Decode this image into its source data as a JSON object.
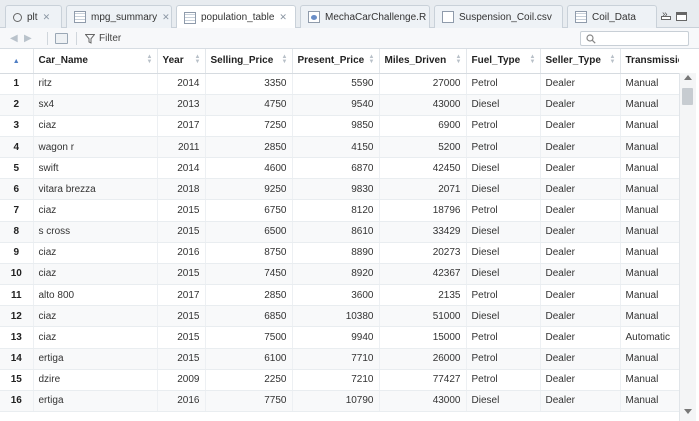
{
  "tabs": [
    {
      "label": "plt",
      "icon": "magnifier-icon"
    },
    {
      "label": "mpg_summary",
      "icon": "grid-icon"
    },
    {
      "label": "population_table",
      "icon": "grid-icon",
      "active": true
    },
    {
      "label": "MechaCarChallenge.R",
      "icon": "r-script-icon"
    },
    {
      "label": "Suspension_Coil.csv",
      "icon": "document-icon"
    },
    {
      "label": "Coil_Data",
      "icon": "grid-icon"
    }
  ],
  "tab_close_glyph": "✕",
  "tab_overflow_glyph": "»",
  "toolbar": {
    "back_glyph": "◀",
    "forward_glyph": "▶",
    "filter_label": "Filter"
  },
  "search": {
    "placeholder": ""
  },
  "table": {
    "columns": [
      "Car_Name",
      "Year",
      "Selling_Price",
      "Present_Price",
      "Miles_Driven",
      "Fuel_Type",
      "Seller_Type",
      "Transmission"
    ],
    "rows": [
      [
        "1",
        "ritz",
        "2014",
        "3350",
        "5590",
        "27000",
        "Petrol",
        "Dealer",
        "Manual"
      ],
      [
        "2",
        "sx4",
        "2013",
        "4750",
        "9540",
        "43000",
        "Diesel",
        "Dealer",
        "Manual"
      ],
      [
        "3",
        "ciaz",
        "2017",
        "7250",
        "9850",
        "6900",
        "Petrol",
        "Dealer",
        "Manual"
      ],
      [
        "4",
        "wagon r",
        "2011",
        "2850",
        "4150",
        "5200",
        "Petrol",
        "Dealer",
        "Manual"
      ],
      [
        "5",
        "swift",
        "2014",
        "4600",
        "6870",
        "42450",
        "Diesel",
        "Dealer",
        "Manual"
      ],
      [
        "6",
        "vitara brezza",
        "2018",
        "9250",
        "9830",
        "2071",
        "Diesel",
        "Dealer",
        "Manual"
      ],
      [
        "7",
        "ciaz",
        "2015",
        "6750",
        "8120",
        "18796",
        "Petrol",
        "Dealer",
        "Manual"
      ],
      [
        "8",
        "s cross",
        "2015",
        "6500",
        "8610",
        "33429",
        "Diesel",
        "Dealer",
        "Manual"
      ],
      [
        "9",
        "ciaz",
        "2016",
        "8750",
        "8890",
        "20273",
        "Diesel",
        "Dealer",
        "Manual"
      ],
      [
        "10",
        "ciaz",
        "2015",
        "7450",
        "8920",
        "42367",
        "Diesel",
        "Dealer",
        "Manual"
      ],
      [
        "11",
        "alto 800",
        "2017",
        "2850",
        "3600",
        "2135",
        "Petrol",
        "Dealer",
        "Manual"
      ],
      [
        "12",
        "ciaz",
        "2015",
        "6850",
        "10380",
        "51000",
        "Diesel",
        "Dealer",
        "Manual"
      ],
      [
        "13",
        "ciaz",
        "2015",
        "7500",
        "9940",
        "15000",
        "Petrol",
        "Dealer",
        "Automatic"
      ],
      [
        "14",
        "ertiga",
        "2015",
        "6100",
        "7710",
        "26000",
        "Petrol",
        "Dealer",
        "Manual"
      ],
      [
        "15",
        "dzire",
        "2009",
        "2250",
        "7210",
        "77427",
        "Petrol",
        "Dealer",
        "Manual"
      ],
      [
        "16",
        "ertiga",
        "2016",
        "7750",
        "10790",
        "43000",
        "Diesel",
        "Dealer",
        "Manual"
      ]
    ]
  }
}
